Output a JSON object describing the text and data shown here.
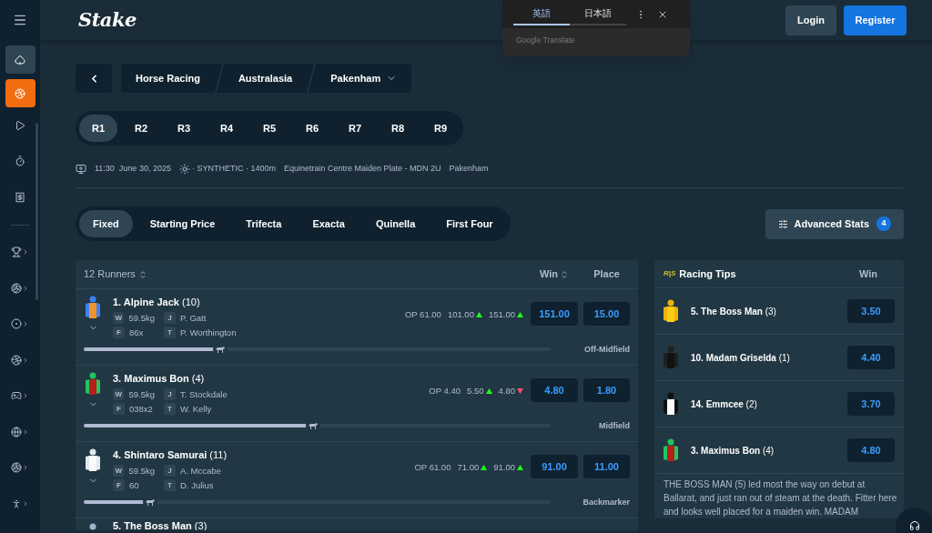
{
  "sidebar": {
    "items": [
      {
        "kind": "tile",
        "selected": false
      },
      {
        "kind": "tile",
        "selected": true
      },
      {
        "kind": "icon",
        "selected": false
      },
      {
        "kind": "icon",
        "selected": false
      },
      {
        "kind": "icon",
        "selected": false
      },
      {
        "kind": "sport",
        "selected": false
      },
      {
        "kind": "sport",
        "selected": false
      },
      {
        "kind": "sport",
        "selected": false
      },
      {
        "kind": "sport",
        "selected": false
      },
      {
        "kind": "sport",
        "selected": false
      },
      {
        "kind": "sport",
        "selected": false
      },
      {
        "kind": "sport",
        "selected": false
      },
      {
        "kind": "sport",
        "selected": false
      }
    ]
  },
  "header": {
    "logo": "Stake",
    "buttons": [
      {
        "label": "Login",
        "kind": "secondary"
      },
      {
        "label": "Register",
        "kind": "primary"
      }
    ]
  },
  "translate_popup": {
    "tabs": [
      {
        "label": "英語",
        "selected": true
      },
      {
        "label": "日本語",
        "selected": false
      }
    ],
    "footer": "Google Translate"
  },
  "breadcrumb": [
    "Horse Racing",
    "Australasia",
    "Pakenham"
  ],
  "races": [
    {
      "label": "R1",
      "selected": true
    },
    {
      "label": "R2",
      "selected": false
    },
    {
      "label": "R3",
      "selected": false
    },
    {
      "label": "R4",
      "selected": false
    },
    {
      "label": "R5",
      "selected": false
    },
    {
      "label": "R6",
      "selected": false
    },
    {
      "label": "R7",
      "selected": false
    },
    {
      "label": "R8",
      "selected": false
    },
    {
      "label": "R9",
      "selected": false
    }
  ],
  "race_info": {
    "time": "11:30",
    "date": "June 30, 2025",
    "track": "· SYNTHETIC · 1400m",
    "race_name": "Equinetrain Centre Maiden Plate - MDN 2U",
    "venue": "Pakenham"
  },
  "bet_types": [
    {
      "label": "Fixed",
      "selected": true
    },
    {
      "label": "Starting Price",
      "selected": false
    },
    {
      "label": "Trifecta",
      "selected": false
    },
    {
      "label": "Exacta",
      "selected": false
    },
    {
      "label": "Quinella",
      "selected": false
    },
    {
      "label": "First Four",
      "selected": false
    }
  ],
  "advanced_stats": {
    "label": "Advanced Stats",
    "count": "4"
  },
  "runners": {
    "title": "12 Runners",
    "columns": [
      "Win",
      "Place"
    ],
    "rows": [
      {
        "kind": "full",
        "name": "**1. Alpine Jack** (10)",
        "silk": {
          "body": {
            "color": "#f0932b"
          },
          "sleeves": {
            "color": "#3b82f6"
          }
        },
        "weight": "59.5kg",
        "jockey": "P. Gatt",
        "form": "86x",
        "trainer": "P. Worthington",
        "labels": {
          "w": "W",
          "j": "J",
          "f": "F",
          "t": "T"
        },
        "prices": [
          {
            "text": "OP 61.00",
            "kind": "opening"
          },
          {
            "text": "101.00",
            "kind": "up"
          },
          {
            "text": "151.00",
            "kind": "up"
          }
        ],
        "win": "151.00",
        "place": "15.00",
        "level": 0.28,
        "position": "Off-Midfield"
      },
      {
        "kind": "full",
        "name": "**3. Maximus Bon** (4)",
        "silk": {
          "body": {
            "color": "#b91c1c"
          },
          "sleeves": {
            "color": "#22c55e"
          }
        },
        "weight": "59.5kg",
        "jockey": "T. Stockdale",
        "form": "038x2",
        "trainer": "W. Kelly",
        "labels": {
          "w": "W",
          "j": "J",
          "f": "F",
          "t": "T"
        },
        "prices": [
          {
            "text": "OP 4.40",
            "kind": "opening"
          },
          {
            "text": "5.50",
            "kind": "up"
          },
          {
            "text": "4.80",
            "kind": "down"
          }
        ],
        "win": "4.80",
        "place": "1.80",
        "level": 0.48,
        "position": "Midfield"
      },
      {
        "kind": "full",
        "name": "**4. Shintaro Samurai** (11)",
        "silk": {
          "body": {
            "color": "#f8fafc"
          },
          "sleeves": {
            "color": "#e2e8f0"
          }
        },
        "weight": "59.5kg",
        "jockey": "A. Mccabe",
        "form": "60",
        "trainer": "D. Julius",
        "labels": {
          "w": "W",
          "j": "J",
          "f": "F",
          "t": "T"
        },
        "prices": [
          {
            "text": "OP 61.00",
            "kind": "opening"
          },
          {
            "text": "71.00",
            "kind": "up"
          },
          {
            "text": "91.00",
            "kind": "up"
          }
        ],
        "win": "91.00",
        "place": "11.00",
        "level": 0.13,
        "position": "Backmarker"
      },
      {
        "kind": "partial",
        "name": "**5. The Boss Man** (3)",
        "cap": {
          "color": "#9fb4cc"
        }
      }
    ]
  },
  "tips": {
    "logo": "R|S",
    "title": "Racing Tips",
    "column": "Win",
    "rows": [
      {
        "name": "**5. The Boss Man** (3)",
        "silk": {
          "body": {
            "color": "#facc15"
          },
          "sleeves": {
            "color": "#eab308"
          }
        },
        "win": "3.50"
      },
      {
        "name": "**10. Madam Griselda** (1)",
        "silk": {
          "body": {
            "color": "#111111"
          },
          "sleeves": {
            "color": "#1f1f1f"
          }
        },
        "win": "4.40"
      },
      {
        "name": "**14. Emmcee** (2)",
        "silk": {
          "body": {
            "color": "#f8fafc"
          },
          "sleeves": {
            "color": "#111111"
          }
        },
        "win": "3.70"
      },
      {
        "name": "**3. Maximus Bon** (4)",
        "silk": {
          "body": {
            "color": "#b91c1c"
          },
          "sleeves": {
            "color": "#22c55e"
          }
        },
        "win": "4.80"
      }
    ],
    "text": "THE BOSS MAN (5) led most the way on debut at Ballarat, and just ran out of steam at the death. Fitter here and looks well placed for a maiden win. MADAM"
  }
}
